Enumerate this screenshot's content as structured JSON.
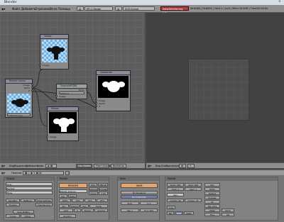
{
  "window": {
    "title": "Blender"
  },
  "menu": {
    "items": [
      "Файл",
      "Добавить",
      "Отрисовка",
      "Окна",
      "Помощь"
    ],
    "screen": "SR:2-Model",
    "scene": "SCE:Scene",
    "stats": "www.blender.org 245",
    "info": "Ve:8084 | Fa:8004 | Ob:0-1 | La:0 | Mem:16.50M | Time:00:00.00"
  },
  "nodes": {
    "viewer": {
      "title": "Viewer",
      "input": "Image"
    },
    "render_layers": {
      "title": "Render Layers",
      "outputs": [
        "Image",
        "Alpha",
        "Z"
      ],
      "layer": "1 RenderLayer"
    },
    "separate": {
      "title": "SeparateRGBA",
      "field": "Distance",
      "sub": "Mode",
      "inputs": [
        "Image"
      ]
    },
    "viewer2": {
      "title": "Viewer",
      "input": "Image"
    },
    "composite": {
      "title": "Composite",
      "inputs": [
        "Image",
        "Alpha",
        "Z"
      ]
    }
  },
  "node_header": {
    "items": [
      "Вид",
      "Выделить",
      "Добавить",
      "Node"
    ],
    "buttons": [
      "Use Nodes",
      "Free Unused",
      "Backdrop"
    ]
  },
  "image_header": {
    "items": [
      "Вид",
      "Изображение"
    ]
  },
  "buttons_header": {
    "label": "Панели",
    "page": "1"
  },
  "panels": {
    "output": {
      "title": "Output",
      "rows": [
        "/tmp/",
        "Backbuf",
        "/ftype"
      ],
      "buttons": [
        "Save/Buf",
        "RGBtype",
        "Edge Settings",
        "Threads",
        "Free Tex Img",
        "Save Buffers",
        "Cycles",
        "Dither"
      ]
    },
    "render": {
      "title": "Render",
      "render_btn": "RENDER",
      "buttons": [
        "OSA",
        "MBLUR",
        "Shadow",
        "EnvMap",
        "Blender Internal",
        "Ray",
        "Radio",
        "Sky",
        "Premul",
        "Key",
        "Rendlay"
      ],
      "values": [
        "Gauss",
        "1.00",
        "100%",
        "75%",
        "50%",
        "25%",
        "Fields",
        "Odd",
        "X",
        "Border",
        "Gamma"
      ]
    },
    "anim": {
      "title": "Anim",
      "buttons": [
        "ANIM",
        "Do Sequence",
        "Do Composite",
        "PLAY",
        "rt: 0"
      ],
      "fields": [
        "Sta: 1",
        "End: 250"
      ]
    },
    "format": {
      "title": "Format",
      "fields": [
        "SizeX: 800",
        "SizeY: 600",
        "AspX: 1",
        "AspY: 1",
        "Quality: 90",
        "Frs/sec: 25"
      ],
      "presets": [
        "Jpeg",
        "PAL",
        "NTSC",
        "Default",
        "Preview",
        "PC",
        "PAL 16:9",
        "PANO",
        "FULL",
        "HD",
        "HDTV"
      ],
      "extra": [
        "Crop",
        "BW",
        "RGB",
        "RGBA"
      ]
    }
  }
}
